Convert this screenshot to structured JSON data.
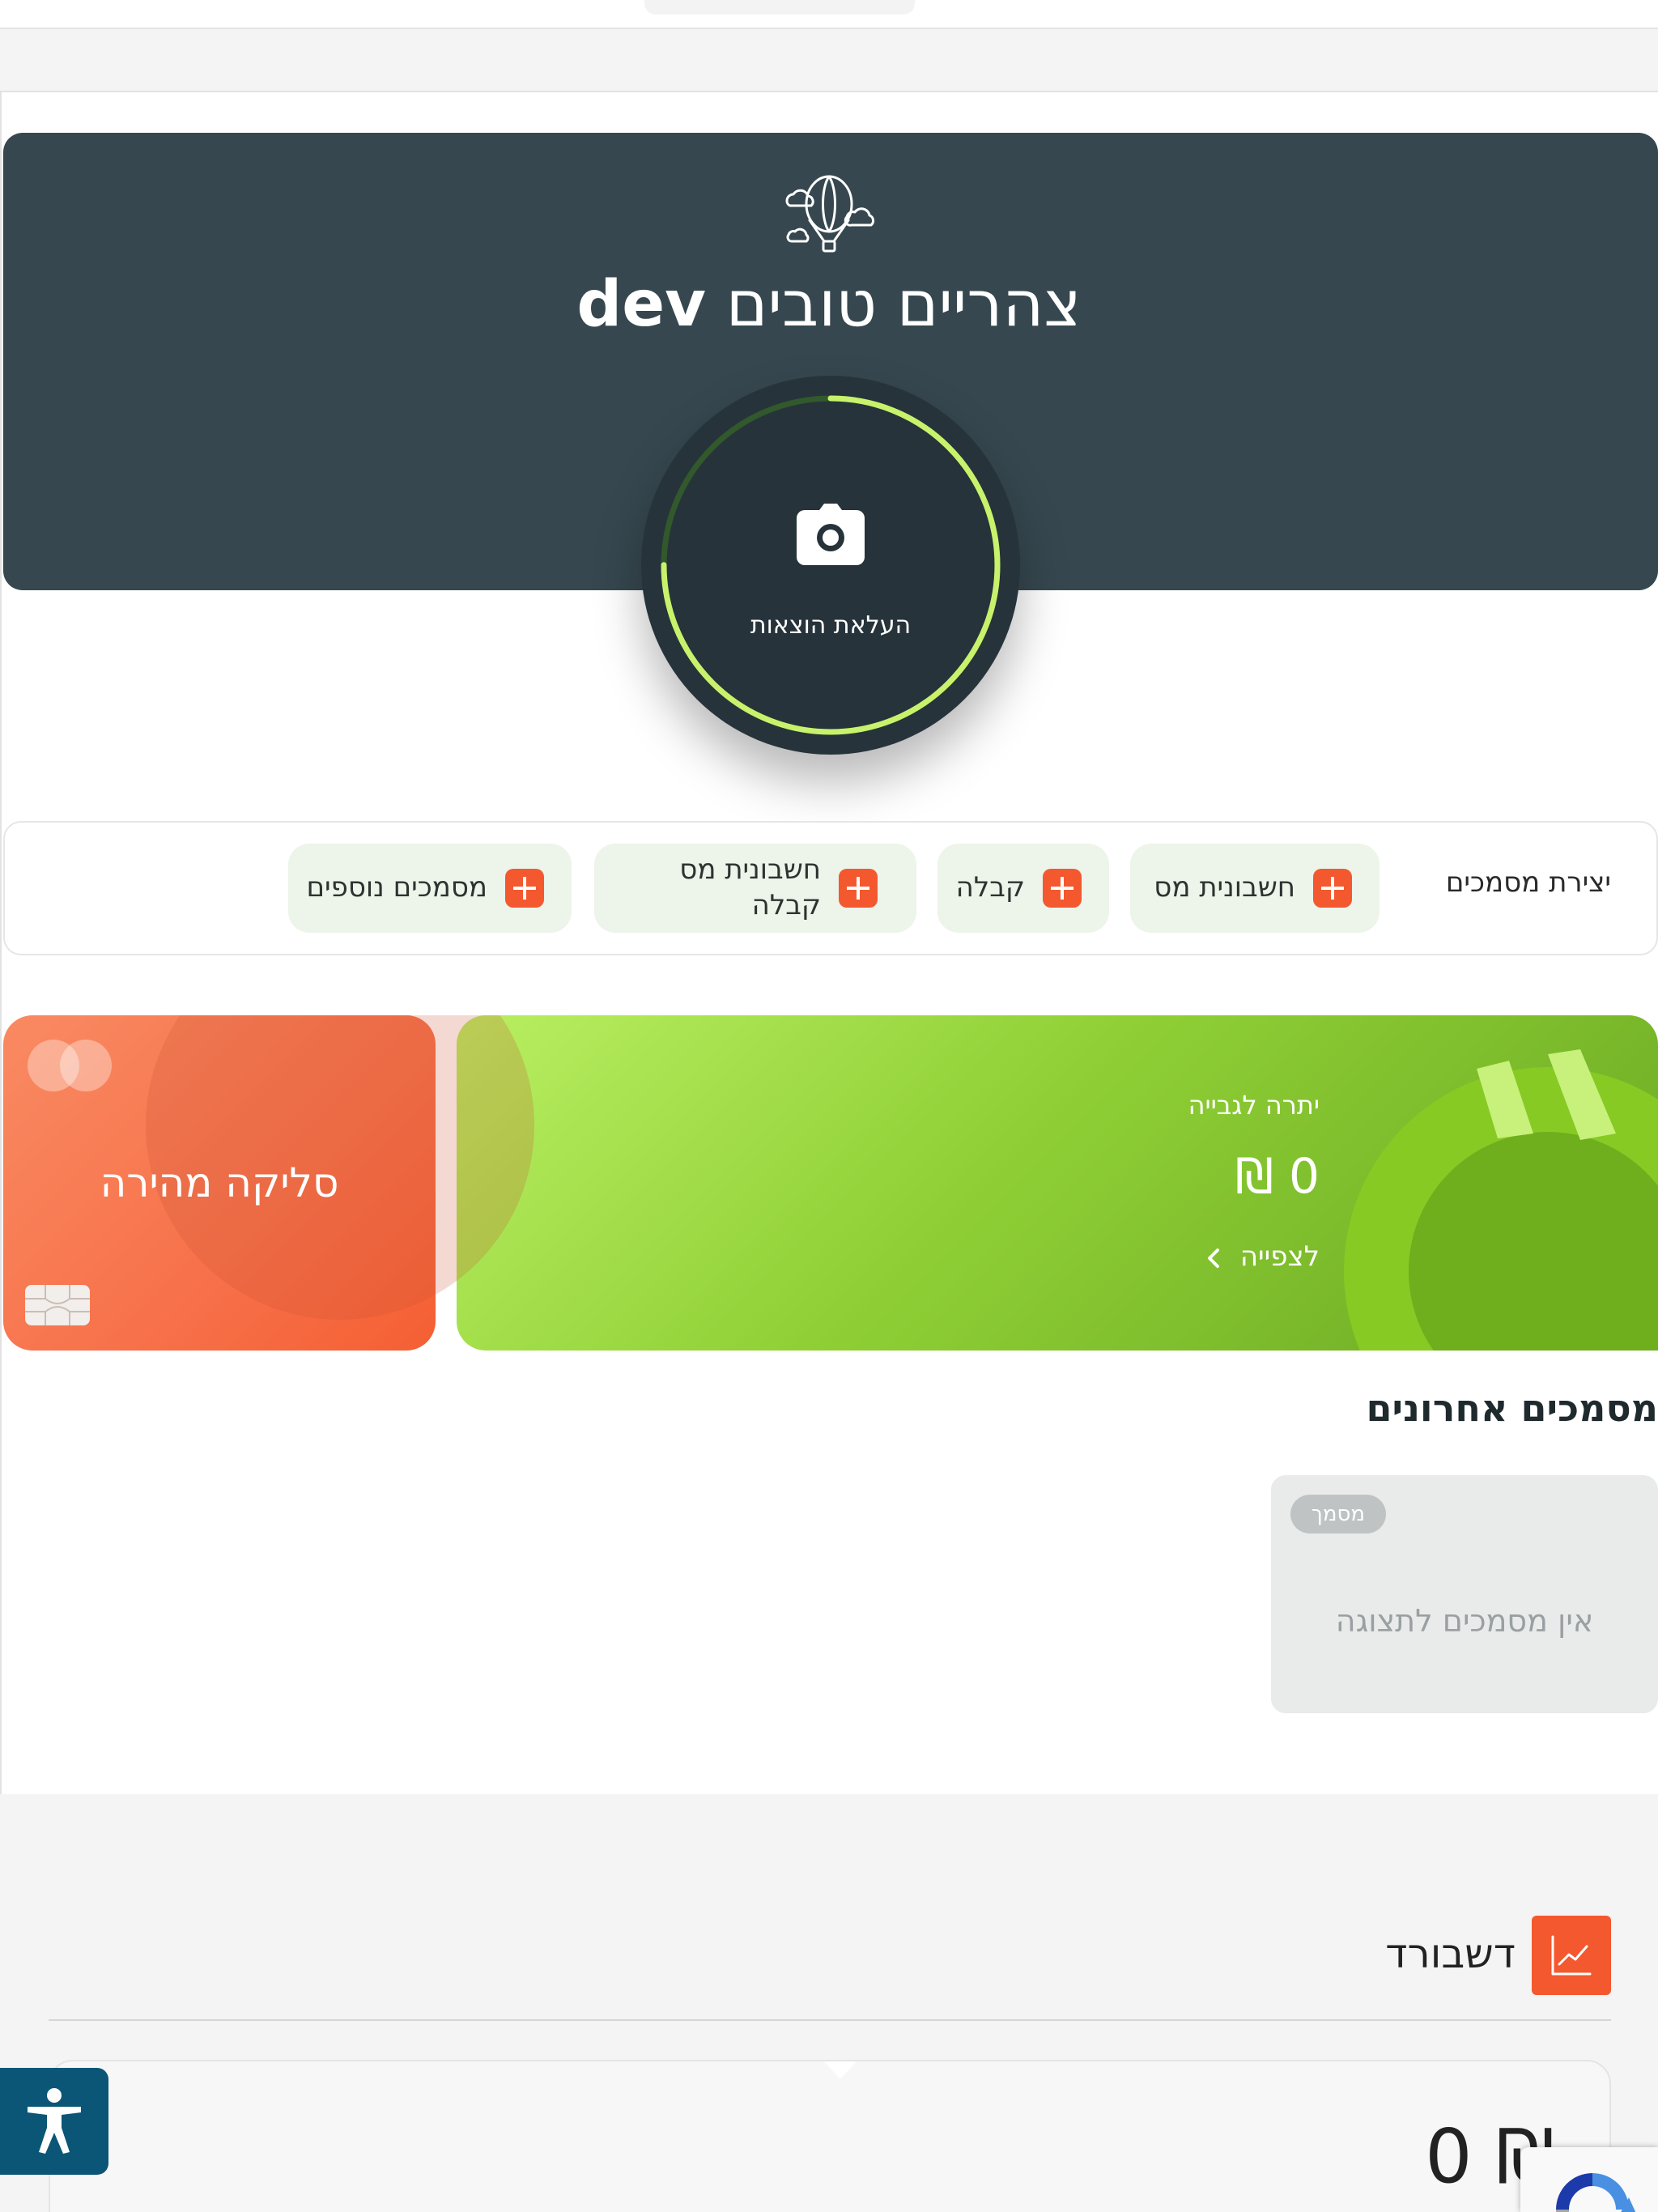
{
  "hero": {
    "greeting_prefix": "צהריים טובים",
    "user_name": "dev",
    "upload_label": "העלאת הוצאות",
    "upload_progress": 0.75
  },
  "create_documents": {
    "title": "יצירת מסמכים",
    "buttons": [
      {
        "label": "חשבונית מס"
      },
      {
        "label": "קבלה"
      },
      {
        "label": "חשבונית מס קבלה"
      },
      {
        "label": "מסמכים נוספים"
      }
    ]
  },
  "balance_card": {
    "title": "יתרה לגבייה",
    "amount": "0 ₪",
    "view_link": "לצפייה"
  },
  "quick_card": {
    "title": "סליקה מהירה"
  },
  "recent_documents": {
    "title": "מסמכים אחרונים",
    "badge": "מסמך",
    "empty_text": "אין מסמכים לתצוגה"
  },
  "dashboard": {
    "title": "דשבורד",
    "amount": "₪ 0"
  },
  "colors": {
    "hero_bg": "#36474f",
    "accent_orange": "#f4582e",
    "accent_green": "#c8f26b",
    "accessibility_blue": "#0b5676"
  }
}
